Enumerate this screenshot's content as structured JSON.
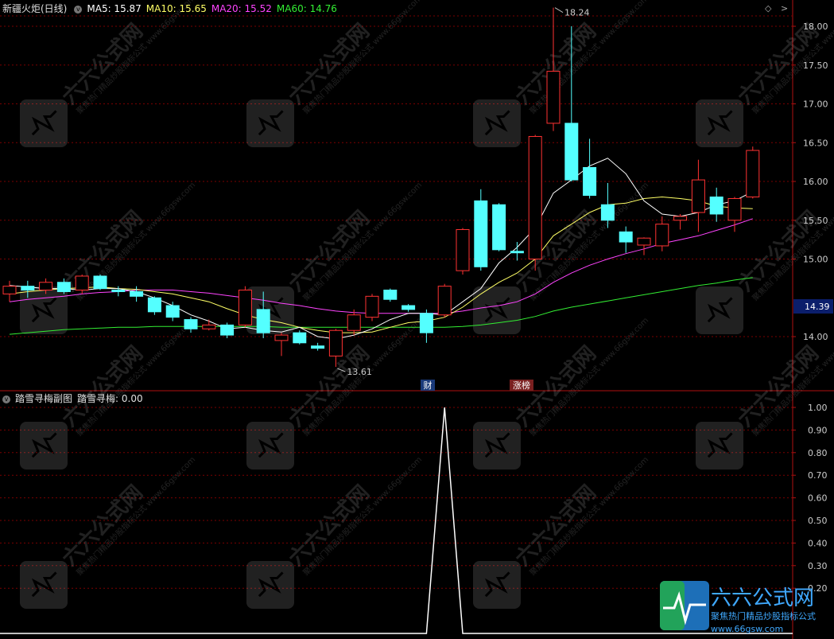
{
  "header": {
    "stock_name": "新疆火炬(日线)",
    "ma": [
      {
        "label": "MA5: 15.87",
        "color": "#ffffff"
      },
      {
        "label": "MA10: 15.65",
        "color": "#ffff66"
      },
      {
        "label": "MA20: 15.52",
        "color": "#ff44ff"
      },
      {
        "label": "MA60: 14.76",
        "color": "#33ee33"
      }
    ]
  },
  "sub_header": {
    "title": "踏雪寻梅副图",
    "value_label": "踏雪寻梅: 0.00"
  },
  "markers": {
    "high": "18.24",
    "low": "13.61",
    "current_price": "14.39",
    "cai": "财",
    "zhangbang": "涨榜"
  },
  "main_axis": [
    "18.00",
    "17.50",
    "17.00",
    "16.50",
    "16.00",
    "15.50",
    "15.00",
    "14.00"
  ],
  "sub_axis": [
    "1.00",
    "0.90",
    "0.80",
    "0.70",
    "0.60",
    "0.50",
    "0.40",
    "0.30",
    "0.20"
  ],
  "watermark": {
    "brand": "六六公式网",
    "slogan": "聚焦热门精品炒股指标公式",
    "url": "www.66gsw.com"
  },
  "colors": {
    "up": "#ff3232",
    "down": "#54ffff",
    "grid": "#7a0000",
    "border": "#b01010",
    "ma5": "#ffffff",
    "ma10": "#ffff66",
    "ma20": "#ff44ff",
    "ma60": "#33ee33"
  },
  "chart_data": {
    "type": "candlestick",
    "price_axis": [
      13.5,
      18.5
    ],
    "candles": [
      {
        "o": 14.55,
        "h": 14.72,
        "l": 14.45,
        "c": 14.65
      },
      {
        "o": 14.65,
        "h": 14.72,
        "l": 14.5,
        "c": 14.6
      },
      {
        "o": 14.6,
        "h": 14.75,
        "l": 14.55,
        "c": 14.7
      },
      {
        "o": 14.7,
        "h": 14.75,
        "l": 14.55,
        "c": 14.58
      },
      {
        "o": 14.6,
        "h": 14.8,
        "l": 14.55,
        "c": 14.78
      },
      {
        "o": 14.78,
        "h": 14.8,
        "l": 14.6,
        "c": 14.62
      },
      {
        "o": 14.6,
        "h": 14.65,
        "l": 14.52,
        "c": 14.58
      },
      {
        "o": 14.58,
        "h": 14.65,
        "l": 14.45,
        "c": 14.52
      },
      {
        "o": 14.5,
        "h": 14.52,
        "l": 14.28,
        "c": 14.32
      },
      {
        "o": 14.4,
        "h": 14.45,
        "l": 14.2,
        "c": 14.25
      },
      {
        "o": 14.22,
        "h": 14.25,
        "l": 14.05,
        "c": 14.1
      },
      {
        "o": 14.1,
        "h": 14.22,
        "l": 14.08,
        "c": 14.15
      },
      {
        "o": 14.15,
        "h": 14.18,
        "l": 13.98,
        "c": 14.02
      },
      {
        "o": 14.15,
        "h": 14.65,
        "l": 14.12,
        "c": 14.6
      },
      {
        "o": 14.35,
        "h": 14.58,
        "l": 13.98,
        "c": 14.05
      },
      {
        "o": 13.95,
        "h": 14.05,
        "l": 13.75,
        "c": 14.02
      },
      {
        "o": 14.05,
        "h": 14.08,
        "l": 13.9,
        "c": 13.92
      },
      {
        "o": 13.88,
        "h": 13.92,
        "l": 13.82,
        "c": 13.85
      },
      {
        "o": 13.75,
        "h": 14.1,
        "l": 13.61,
        "c": 14.08
      },
      {
        "o": 14.08,
        "h": 14.35,
        "l": 14.02,
        "c": 14.28
      },
      {
        "o": 14.25,
        "h": 14.55,
        "l": 14.2,
        "c": 14.52
      },
      {
        "o": 14.6,
        "h": 14.62,
        "l": 14.45,
        "c": 14.48
      },
      {
        "o": 14.4,
        "h": 14.42,
        "l": 14.32,
        "c": 14.35
      },
      {
        "o": 14.3,
        "h": 14.35,
        "l": 13.92,
        "c": 14.05
      },
      {
        "o": 14.28,
        "h": 14.68,
        "l": 14.25,
        "c": 14.65
      },
      {
        "o": 14.85,
        "h": 15.4,
        "l": 14.8,
        "c": 15.38
      },
      {
        "o": 15.75,
        "h": 15.9,
        "l": 14.85,
        "c": 14.9
      },
      {
        "o": 15.7,
        "h": 15.72,
        "l": 15.1,
        "c": 15.12
      },
      {
        "o": 15.1,
        "h": 15.22,
        "l": 14.98,
        "c": 15.08
      },
      {
        "o": 15.0,
        "h": 16.6,
        "l": 14.85,
        "c": 16.58
      },
      {
        "o": 16.75,
        "h": 18.24,
        "l": 16.65,
        "c": 17.42
      },
      {
        "o": 16.75,
        "h": 18.0,
        "l": 16.0,
        "c": 16.02
      },
      {
        "o": 16.18,
        "h": 16.55,
        "l": 15.78,
        "c": 15.82
      },
      {
        "o": 15.7,
        "h": 15.98,
        "l": 15.4,
        "c": 15.5
      },
      {
        "o": 15.35,
        "h": 15.42,
        "l": 15.08,
        "c": 15.22
      },
      {
        "o": 15.18,
        "h": 15.28,
        "l": 15.05,
        "c": 15.27
      },
      {
        "o": 15.17,
        "h": 15.55,
        "l": 15.1,
        "c": 15.45
      },
      {
        "o": 15.5,
        "h": 15.58,
        "l": 15.38,
        "c": 15.55
      },
      {
        "o": 15.6,
        "h": 16.28,
        "l": 15.35,
        "c": 16.02
      },
      {
        "o": 15.8,
        "h": 15.92,
        "l": 15.48,
        "c": 15.58
      },
      {
        "o": 15.5,
        "h": 15.8,
        "l": 15.35,
        "c": 15.78
      },
      {
        "o": 15.8,
        "h": 16.45,
        "l": 15.78,
        "c": 16.4
      }
    ],
    "ma5": [
      14.66,
      14.64,
      14.62,
      14.62,
      14.6,
      14.62,
      14.62,
      14.58,
      14.5,
      14.4,
      14.28,
      14.2,
      14.1,
      14.12,
      14.08,
      14.06,
      14.12,
      14.0,
      13.97,
      14.02,
      14.1,
      14.22,
      14.3,
      14.3,
      14.28,
      14.45,
      14.62,
      14.95,
      15.15,
      15.4,
      15.85,
      16.02,
      16.2,
      16.3,
      16.1,
      15.75,
      15.58,
      15.55,
      15.6,
      15.7,
      15.75,
      15.87
    ],
    "ma10": [
      14.55,
      14.58,
      14.6,
      14.62,
      14.63,
      14.64,
      14.62,
      14.61,
      14.58,
      14.55,
      14.5,
      14.45,
      14.36,
      14.28,
      14.22,
      14.18,
      14.12,
      14.08,
      14.05,
      14.05,
      14.06,
      14.12,
      14.18,
      14.2,
      14.25,
      14.38,
      14.55,
      14.7,
      14.82,
      15.0,
      15.3,
      15.45,
      15.6,
      15.7,
      15.72,
      15.78,
      15.8,
      15.78,
      15.75,
      15.68,
      15.66,
      15.65
    ],
    "ma20": [
      14.45,
      14.48,
      14.5,
      14.52,
      14.55,
      14.57,
      14.58,
      14.6,
      14.6,
      14.6,
      14.58,
      14.56,
      14.53,
      14.5,
      14.47,
      14.43,
      14.4,
      14.36,
      14.33,
      14.31,
      14.3,
      14.3,
      14.3,
      14.3,
      14.3,
      14.33,
      14.37,
      14.4,
      14.45,
      14.55,
      14.7,
      14.82,
      14.92,
      15.0,
      15.07,
      15.13,
      15.2,
      15.25,
      15.3,
      15.37,
      15.44,
      15.52
    ],
    "ma60": [
      14.03,
      14.05,
      14.07,
      14.09,
      14.1,
      14.11,
      14.12,
      14.12,
      14.13,
      14.13,
      14.13,
      14.13,
      14.13,
      14.13,
      14.13,
      14.12,
      14.12,
      14.12,
      14.12,
      14.12,
      14.12,
      14.12,
      14.12,
      14.12,
      14.12,
      14.13,
      14.15,
      14.18,
      14.21,
      14.26,
      14.33,
      14.38,
      14.42,
      14.46,
      14.5,
      14.54,
      14.58,
      14.62,
      14.66,
      14.69,
      14.73,
      14.76
    ],
    "sub_indicator": {
      "name": "踏雪寻梅",
      "axis": [
        0.2,
        1.0
      ],
      "values": [
        0,
        0,
        0,
        0,
        0,
        0,
        0,
        0,
        0,
        0,
        0,
        0,
        0,
        0,
        0,
        0,
        0,
        0,
        0,
        0,
        0,
        0,
        0,
        0,
        1,
        0,
        0,
        0,
        0,
        0,
        0,
        0,
        0,
        0,
        0,
        0,
        0,
        0,
        0,
        0,
        0,
        0
      ]
    }
  }
}
